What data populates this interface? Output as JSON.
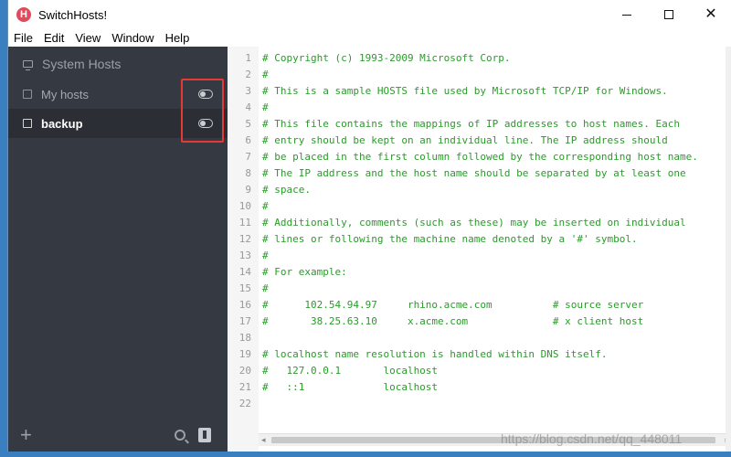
{
  "window": {
    "title": "SwitchHosts!",
    "app_icon_letter": "H",
    "minimize_icon": "minimize-icon",
    "maximize_icon": "maximize-icon",
    "close_icon": "close-icon",
    "close_glyph": "✕"
  },
  "menu": [
    "File",
    "Edit",
    "View",
    "Window",
    "Help"
  ],
  "sidebar": {
    "system_label": "System Hosts",
    "items": [
      {
        "label": "My hosts",
        "enabled": false,
        "selected": false
      },
      {
        "label": "backup",
        "enabled": false,
        "selected": true
      }
    ],
    "add_glyph": "+",
    "colors": {
      "background": "#353a42",
      "selected": "#2b2f35",
      "highlight_box": "#e53935"
    }
  },
  "editor": {
    "lines": [
      "# Copyright (c) 1993-2009 Microsoft Corp.",
      "#",
      "# This is a sample HOSTS file used by Microsoft TCP/IP for Windows.",
      "#",
      "# This file contains the mappings of IP addresses to host names. Each",
      "# entry should be kept on an individual line. The IP address should",
      "# be placed in the first column followed by the corresponding host name.",
      "# The IP address and the host name should be separated by at least one",
      "# space.",
      "#",
      "# Additionally, comments (such as these) may be inserted on individual",
      "# lines or following the machine name denoted by a '#' symbol.",
      "#",
      "# For example:",
      "#",
      "#      102.54.94.97     rhino.acme.com          # source server",
      "#       38.25.63.10     x.acme.com              # x client host",
      "",
      "# localhost name resolution is handled within DNS itself.",
      "#   127.0.0.1       localhost",
      "#   ::1             localhost",
      ""
    ],
    "line_numbers": [
      "1",
      "2",
      "3",
      "4",
      "5",
      "6",
      "7",
      "8",
      "9",
      "10",
      "11",
      "12",
      "13",
      "14",
      "15",
      "16",
      "17",
      "18",
      "19",
      "20",
      "21",
      "22"
    ],
    "comment_color": "#2a9b2a"
  },
  "scrollbar": {
    "left_arrow": "◂",
    "right_arrow": "▸"
  },
  "watermark": "https://blog.csdn.net/qq_448011"
}
